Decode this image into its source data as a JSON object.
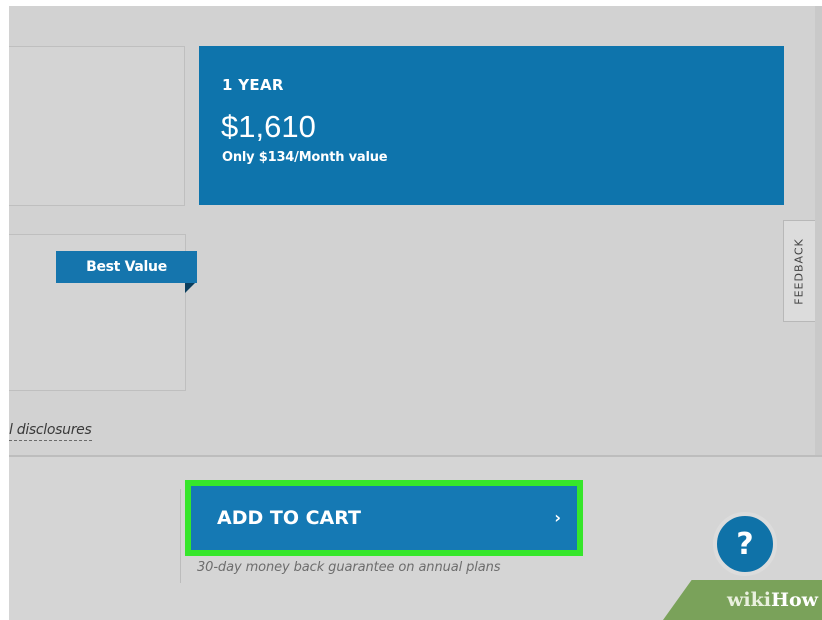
{
  "plans": {
    "selected": {
      "term": "1 YEAR",
      "price": "$1,610",
      "monthly": "Only $134/Month value"
    },
    "badge": "Best Value"
  },
  "feedback_tab": {
    "label": "FEEDBACK"
  },
  "disclosures_link": "l disclosures",
  "cart": {
    "add_to_cart_label": "ADD TO CART",
    "chevron": "›",
    "guarantee": "30-day money back guarantee on annual plans"
  },
  "help": {
    "label": "?"
  },
  "watermark": {
    "wiki": "wiki",
    "how": "How"
  },
  "colors": {
    "selected_plan": "#0e74ac",
    "cart_button": "#1579b4",
    "highlight": "#36e62b",
    "background": "#d5d5d5"
  }
}
